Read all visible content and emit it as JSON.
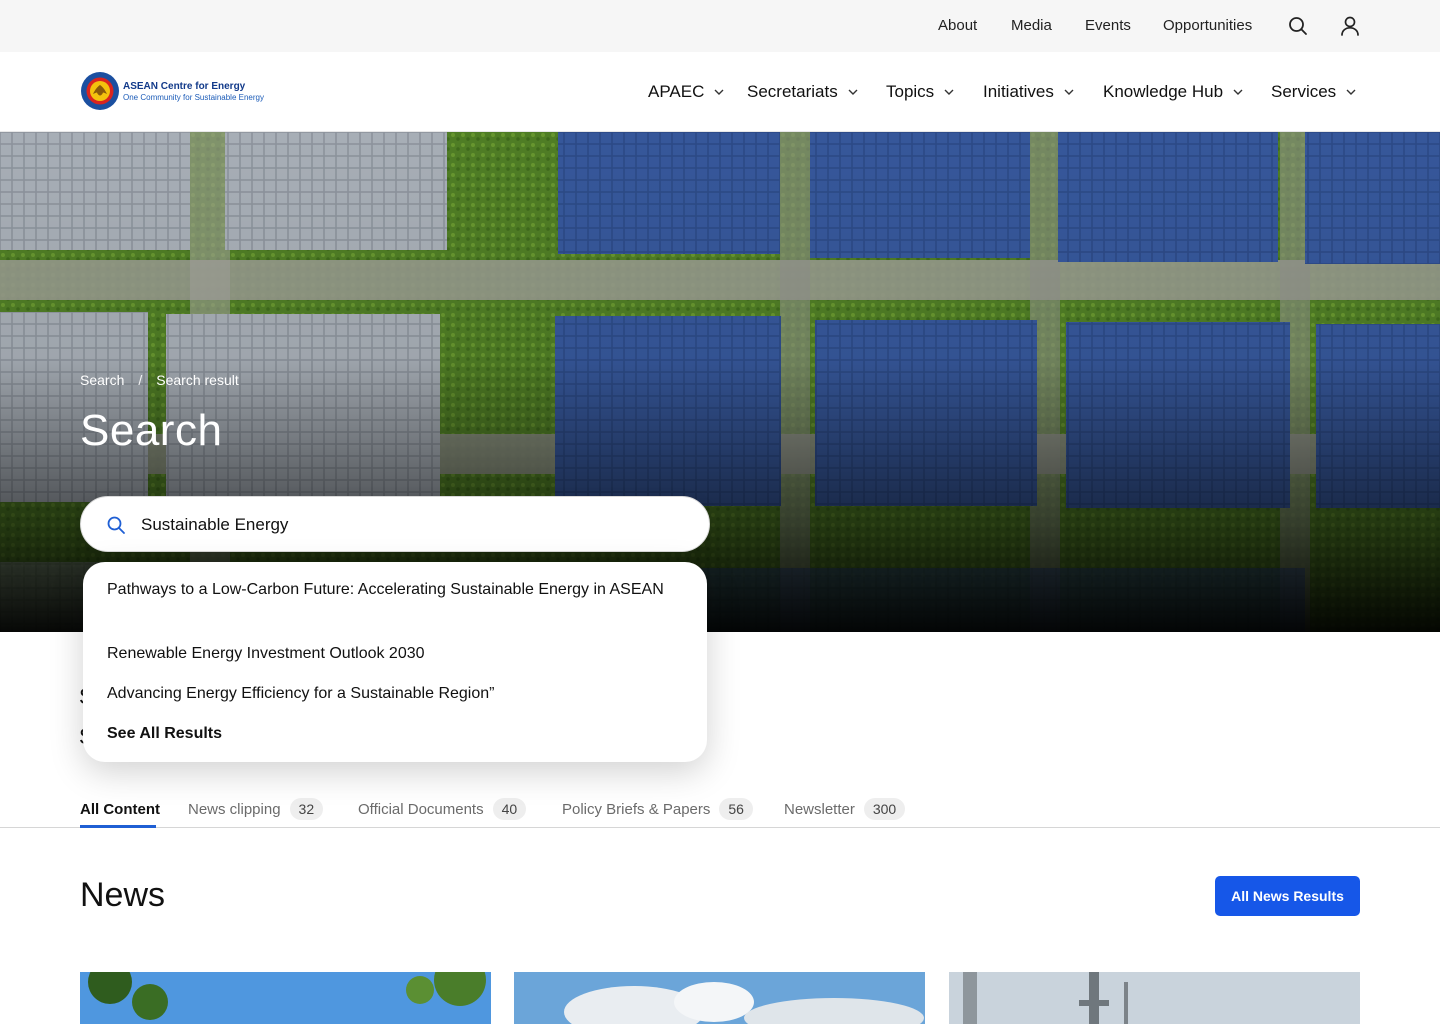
{
  "topbar": {
    "links": [
      "About",
      "Media",
      "Events",
      "Opportunities"
    ],
    "search_icon": "search-icon",
    "user_icon": "user-icon"
  },
  "logo": {
    "title": "ASEAN Centre for Energy",
    "subtitle": "One Community for Sustainable Energy"
  },
  "nav": {
    "items": [
      {
        "label": "APAEC"
      },
      {
        "label": "Secretariats"
      },
      {
        "label": "Topics"
      },
      {
        "label": "Initiatives"
      },
      {
        "label": "Knowledge Hub"
      },
      {
        "label": "Services"
      }
    ]
  },
  "hero": {
    "breadcrumb": [
      "Search",
      "Search result"
    ],
    "breadcrumb_sep": "/",
    "title": "Search"
  },
  "search": {
    "value": "Sustainable Energy",
    "suggestions": [
      "Pathways to a Low-Carbon Future: Accelerating Sustainable Energy in ASEAN",
      "Renewable Energy Investment Outlook 2030",
      "Advancing Energy Efficiency for a Sustainable Region”"
    ],
    "see_all": "See All Results"
  },
  "tabs": [
    {
      "label": "All Content",
      "count": null,
      "active": true
    },
    {
      "label": "News clipping",
      "count": "32"
    },
    {
      "label": "Official Documents",
      "count": "40"
    },
    {
      "label": "Policy Briefs & Papers",
      "count": "56"
    },
    {
      "label": "Newsletter",
      "count": "300"
    }
  ],
  "news": {
    "title": "News",
    "button": "All News Results"
  },
  "colors": {
    "accent": "#1657e8",
    "tab_underline": "#1f5fd4",
    "topbar_bg": "#f6f6f6"
  }
}
